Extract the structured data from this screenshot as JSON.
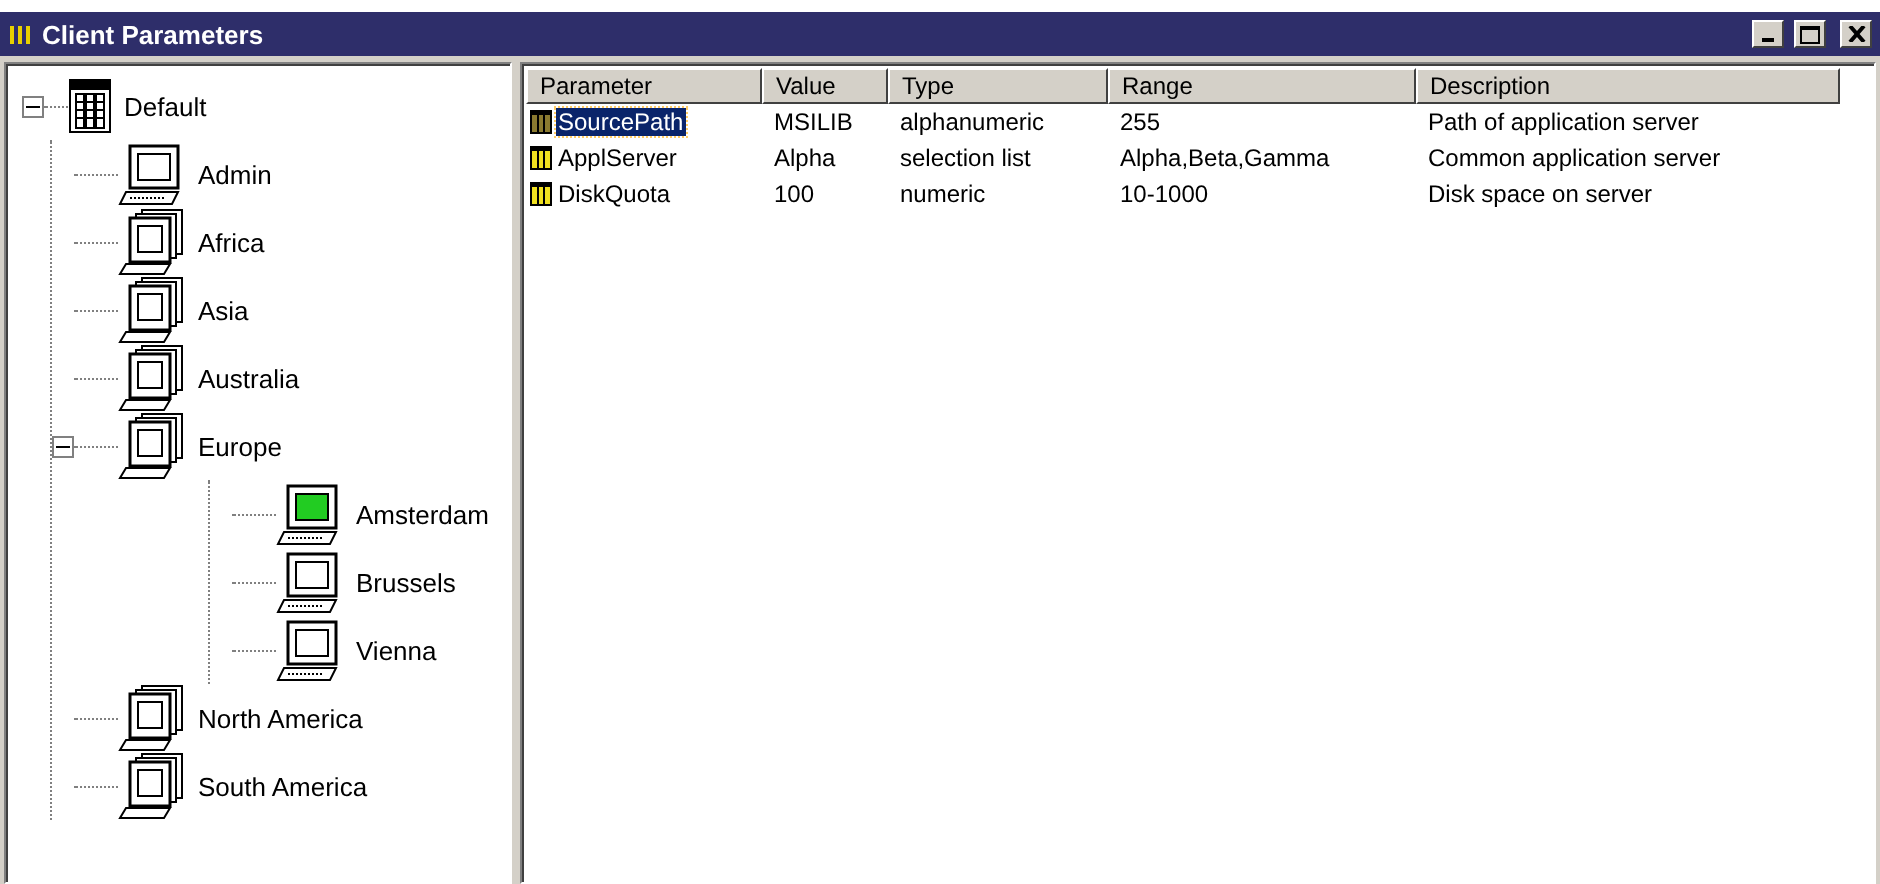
{
  "window": {
    "title": "Client Parameters"
  },
  "tree": {
    "label": "Default",
    "kind": "root",
    "expanded": true,
    "children": [
      {
        "label": "Admin",
        "kind": "computer",
        "highlighted": false
      },
      {
        "label": "Africa",
        "kind": "group",
        "highlighted": false
      },
      {
        "label": "Asia",
        "kind": "group",
        "highlighted": false
      },
      {
        "label": "Australia",
        "kind": "group",
        "highlighted": false
      },
      {
        "label": "Europe",
        "kind": "group",
        "highlighted": false,
        "expanded": true,
        "children": [
          {
            "label": "Amsterdam",
            "kind": "computer",
            "highlighted": true
          },
          {
            "label": "Brussels",
            "kind": "computer",
            "highlighted": false
          },
          {
            "label": "Vienna",
            "kind": "computer",
            "highlighted": false
          }
        ]
      },
      {
        "label": "North America",
        "kind": "group",
        "highlighted": false
      },
      {
        "label": "South America",
        "kind": "group",
        "highlighted": false
      }
    ]
  },
  "table": {
    "columns": [
      "Parameter",
      "Value",
      "Type",
      "Range",
      "Description"
    ],
    "rows": [
      {
        "cells": [
          "SourcePath",
          "MSILIB",
          "alphanumeric",
          "255",
          "Path of application server"
        ],
        "selected": true
      },
      {
        "cells": [
          "ApplServer",
          "Alpha",
          "selection list",
          "Alpha,Beta,Gamma",
          "Common application server"
        ],
        "selected": false
      },
      {
        "cells": [
          "DiskQuota",
          "100",
          "numeric",
          "10-1000",
          "Disk space on server"
        ],
        "selected": false
      }
    ]
  }
}
